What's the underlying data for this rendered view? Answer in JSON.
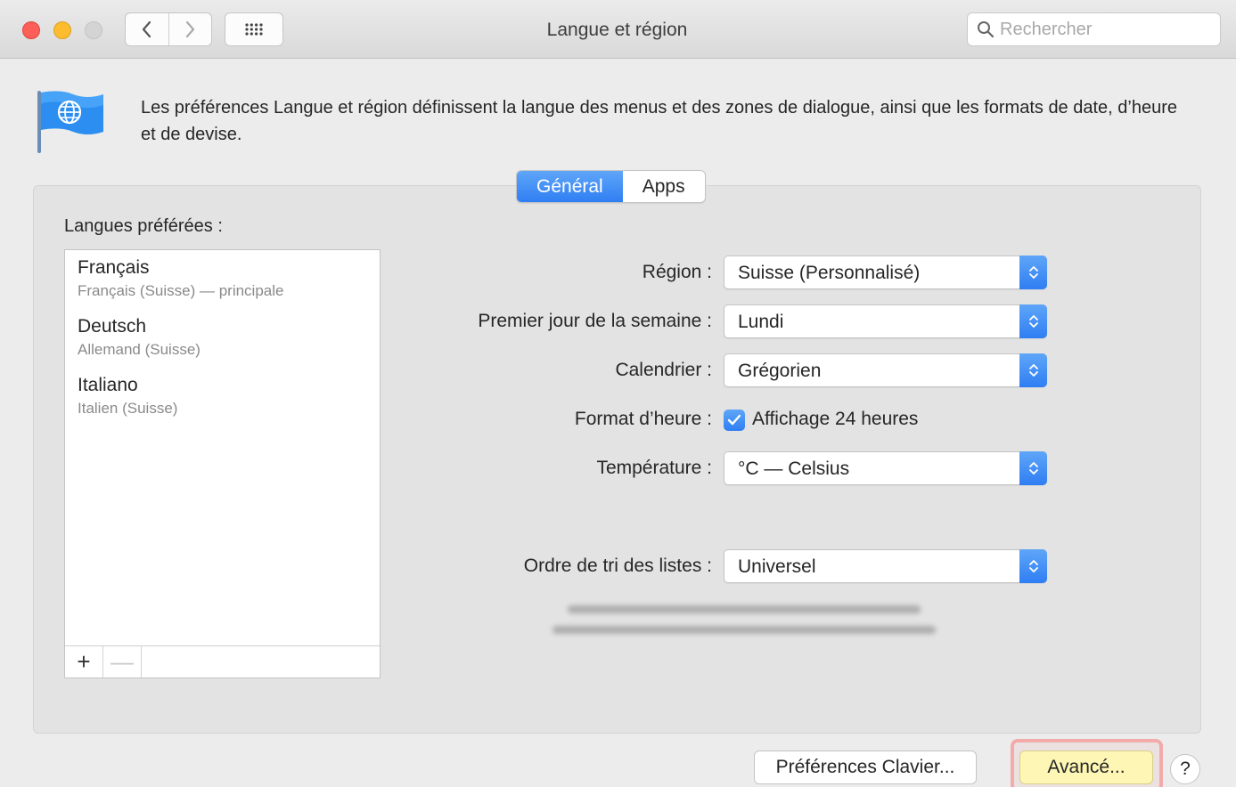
{
  "window": {
    "title": "Langue et région",
    "search_placeholder": "Rechercher"
  },
  "header": {
    "icon": "flag-globe-icon",
    "description": "Les préférences Langue et région définissent la langue des menus et des zones de dialogue, ainsi que les formats de date, d’heure et de devise."
  },
  "tabs": [
    {
      "label": "Général",
      "active": true
    },
    {
      "label": "Apps",
      "active": false
    }
  ],
  "languages": {
    "label": "Langues préférées :",
    "items": [
      {
        "name": "Français",
        "detail": "Français (Suisse) — principale"
      },
      {
        "name": "Deutsch",
        "detail": "Allemand (Suisse)"
      },
      {
        "name": "Italiano",
        "detail": "Italien (Suisse)"
      }
    ],
    "add_label": "+",
    "remove_label": "—"
  },
  "settings": {
    "region": {
      "label": "Région :",
      "value": "Suisse (Personnalisé)"
    },
    "first_day": {
      "label": "Premier jour de la semaine :",
      "value": "Lundi"
    },
    "calendar": {
      "label": "Calendrier :",
      "value": "Grégorien"
    },
    "time_format": {
      "label": "Format d’heure :",
      "checkbox_label": "Affichage 24 heures",
      "checked": true
    },
    "temperature": {
      "label": "Température :",
      "value": "°C — Celsius"
    },
    "sort_order": {
      "label": "Ordre de tri des listes :",
      "value": "Universel"
    }
  },
  "buttons": {
    "keyboard_prefs": "Préférences Clavier...",
    "advanced": "Avancé...",
    "help": "?"
  },
  "colors": {
    "accent": "#2f7ef3",
    "highlight_border": "#f3aaaa",
    "highlight_fill": "#fdf6b4"
  }
}
